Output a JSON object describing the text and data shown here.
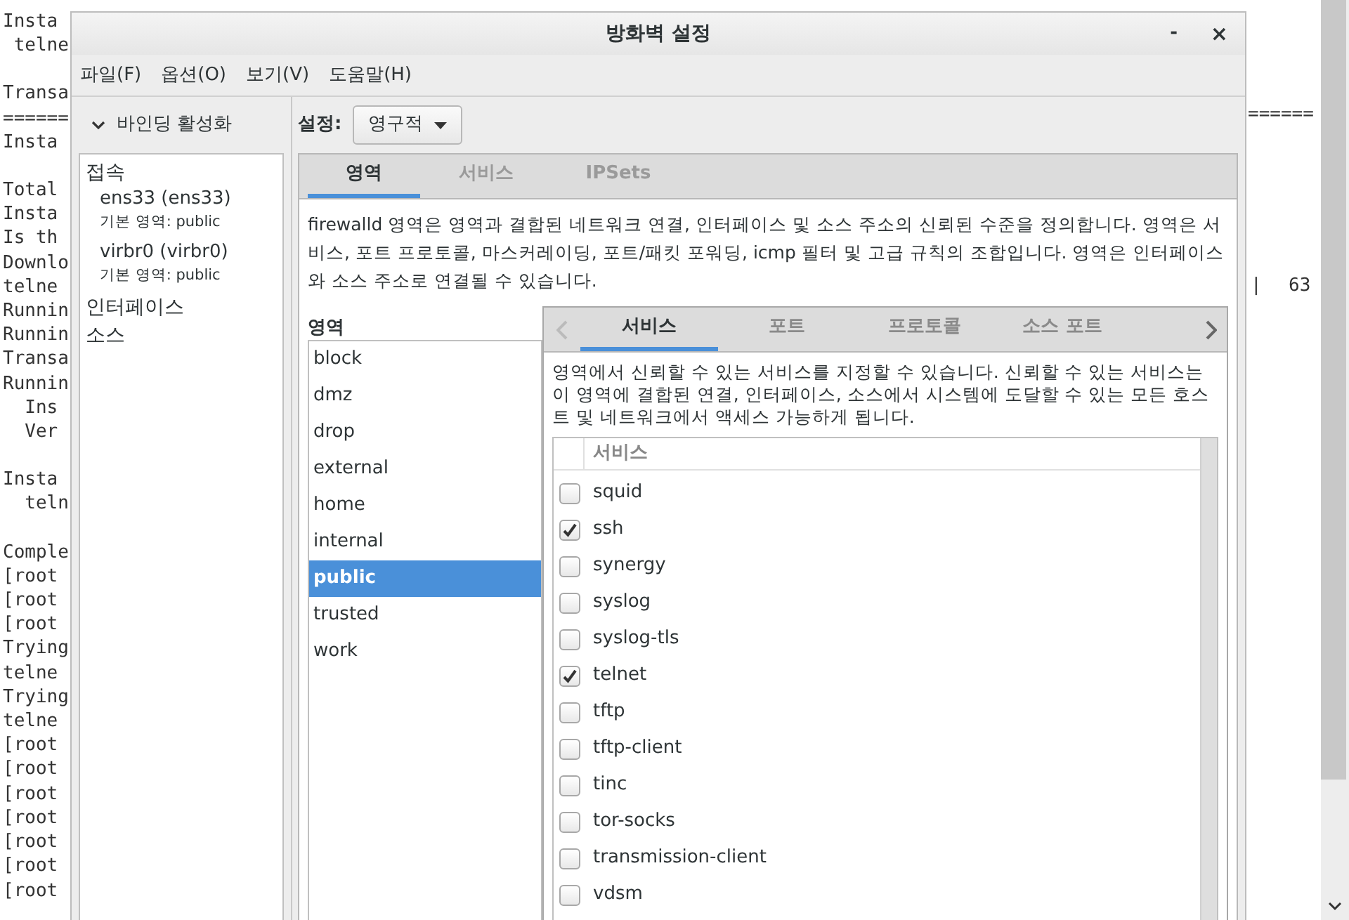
{
  "terminal": {
    "blocks": [
      [
        "Insta",
        " telne"
      ],
      [
        "Transa",
        "======",
        "Insta"
      ],
      [
        "Total",
        "Insta",
        "Is th",
        "Downlo",
        "telne",
        "Runnin",
        "Runnin",
        "Transa",
        "Runnin",
        "  Ins",
        "  Ver"
      ],
      [
        "Insta",
        "  teln"
      ],
      [
        "Comple",
        "[root",
        "[root",
        "[root",
        "Trying",
        "telne",
        "Trying",
        "telne",
        "[root",
        "[root",
        "[root",
        "[root",
        "[root",
        "[root",
        "[root"
      ]
    ],
    "right_rule": "======",
    "right_column_1": "|",
    "right_column_2": "63"
  },
  "window": {
    "title": "방화벽 설정",
    "minimize": "-",
    "close": "×"
  },
  "menu": [
    "파일(F)",
    "옵션(O)",
    "보기(V)",
    "도움말(H)"
  ],
  "sidebar": {
    "header": "바인딩 활성화",
    "expanded": true,
    "items": [
      {
        "label": "접속",
        "children": [
          {
            "label": "ens33 (ens33)",
            "subtitle": "기본 영역: public"
          },
          {
            "label": "virbr0 (virbr0)",
            "subtitle": "기본 영역: public"
          }
        ]
      },
      {
        "label": "인터페이스"
      },
      {
        "label": "소스"
      }
    ]
  },
  "config": {
    "label": "설정:",
    "value": "영구적"
  },
  "tabs": [
    {
      "label": "영역",
      "selected": true
    },
    {
      "label": "서비스",
      "selected": false
    },
    {
      "label": "IPSets",
      "selected": false
    }
  ],
  "zone_description": "firewalld 영역은 영역과 결합된 네트워크 연결, 인터페이스 및 소스 주소의 신뢰된 수준을 정의합니다. 영역은 서비스, 포트 프로토콜, 마스커레이딩, 포트/패킷 포워딩, icmp 필터 및 고급 규칙의 조합입니다. 영역은 인터페이스와 소스 주소로 연결될 수 있습니다.",
  "zones": {
    "label": "영역",
    "items": [
      {
        "name": "block",
        "selected": false
      },
      {
        "name": "dmz",
        "selected": false
      },
      {
        "name": "drop",
        "selected": false
      },
      {
        "name": "external",
        "selected": false
      },
      {
        "name": "home",
        "selected": false
      },
      {
        "name": "internal",
        "selected": false
      },
      {
        "name": "public",
        "selected": true
      },
      {
        "name": "trusted",
        "selected": false
      },
      {
        "name": "work",
        "selected": false
      }
    ]
  },
  "zone_tabs": [
    {
      "label": "서비스",
      "selected": true
    },
    {
      "label": "포트",
      "selected": false
    },
    {
      "label": "프로토콜",
      "selected": false
    },
    {
      "label": "소스 포트",
      "selected": false
    }
  ],
  "services": {
    "description": "영역에서 신뢰할 수 있는 서비스를 지정할 수 있습니다. 신뢰할 수 있는 서비스는 이 영역에 결합된 연결, 인터페이스, 소스에서 시스템에 도달할 수 있는 모든 호스트 및 네트워크에서 액세스 가능하게 됩니다.",
    "column": "서비스",
    "rows": [
      {
        "name": "squid",
        "checked": false
      },
      {
        "name": "ssh",
        "checked": true
      },
      {
        "name": "synergy",
        "checked": false
      },
      {
        "name": "syslog",
        "checked": false
      },
      {
        "name": "syslog-tls",
        "checked": false
      },
      {
        "name": "telnet",
        "checked": true
      },
      {
        "name": "tftp",
        "checked": false
      },
      {
        "name": "tftp-client",
        "checked": false
      },
      {
        "name": "tinc",
        "checked": false
      },
      {
        "name": "tor-socks",
        "checked": false
      },
      {
        "name": "transmission-client",
        "checked": false
      },
      {
        "name": "vdsm",
        "checked": false
      }
    ]
  }
}
